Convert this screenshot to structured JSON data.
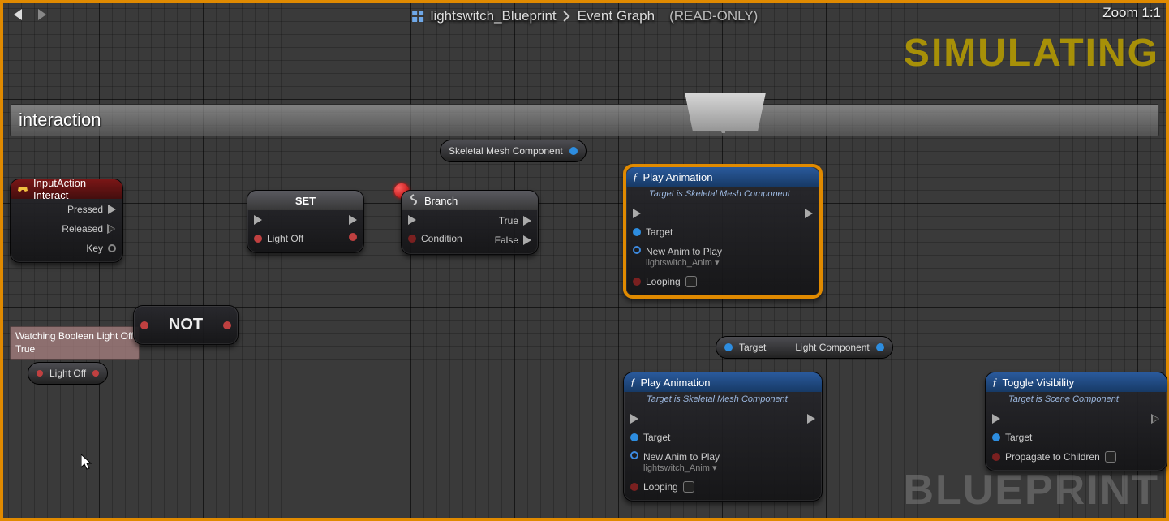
{
  "top": {
    "crumb1": "lightswitch_Blueprint",
    "crumb2": "Event Graph",
    "readonly": "(READ-ONLY)",
    "zoom": "Zoom 1:1"
  },
  "watermarks": {
    "simulating": "SIMULATING",
    "blueprint": "BLUEPRINT"
  },
  "section": {
    "title": "interaction"
  },
  "nodes": {
    "input": {
      "title": "InputAction Interact",
      "pressed": "Pressed",
      "released": "Released",
      "key": "Key"
    },
    "set": {
      "title": "SET",
      "lightoff": "Light Off"
    },
    "branch": {
      "title": "Branch",
      "cond": "Condition",
      "true": "True",
      "false": "False"
    },
    "not": {
      "title": "NOT"
    },
    "lightoff_get": {
      "label": "Light Off"
    },
    "skm": {
      "label": "Skeletal Mesh Component"
    },
    "reroute": {
      "target": "Target",
      "lightcomp": "Light Component"
    },
    "play1": {
      "title": "Play Animation",
      "sub": "Target is Skeletal Mesh Component",
      "target": "Target",
      "newanim": "New Anim to Play",
      "asset": "lightswitch_Anim",
      "looping": "Looping"
    },
    "play2": {
      "title": "Play Animation",
      "sub": "Target is Skeletal Mesh Component",
      "target": "Target",
      "newanim": "New Anim to Play",
      "asset": "lightswitch_Anim",
      "looping": "Looping"
    },
    "toggle": {
      "title": "Toggle Visibility",
      "sub": "Target is Scene Component",
      "target": "Target",
      "propagate": "Propagate to Children"
    }
  },
  "tooltip": {
    "line1": "Watching Boolean Light Off",
    "line2": "True"
  }
}
